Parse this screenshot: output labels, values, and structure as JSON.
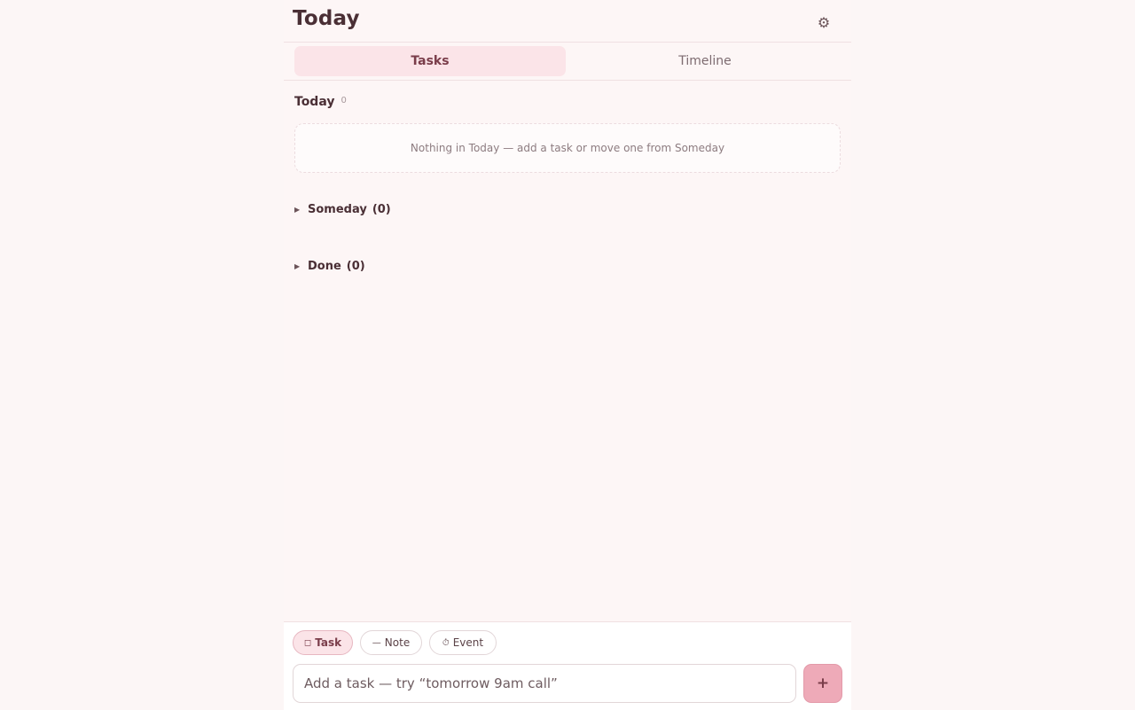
{
  "header": {
    "title": "Today",
    "settings_icon": "⚙"
  },
  "tabs": [
    {
      "label": "Tasks",
      "active": true
    },
    {
      "label": "Timeline",
      "active": false
    }
  ],
  "today_section": {
    "title": "Today",
    "count": "0",
    "empty_message": "Nothing in Today — add a task or move one from Someday"
  },
  "someday_section": {
    "caret": "▶",
    "title": "Someday",
    "count": "(0)"
  },
  "done_section": {
    "caret": "▶",
    "title": "Done",
    "count": "(0)"
  },
  "composer": {
    "modes": [
      {
        "icon": "◻",
        "label": "Task",
        "active": true
      },
      {
        "icon": "—",
        "label": "Note",
        "active": false
      },
      {
        "icon": "⏱",
        "label": "Event",
        "active": false
      }
    ],
    "input_placeholder": "Add a task — try “tomorrow 9am call”",
    "input_value": "",
    "add_button": "+"
  },
  "colors": {
    "background": "#fdf6f6",
    "accent": "#eeaab8",
    "active_tab": "#fbe4e8",
    "text": "#4a2f35"
  }
}
